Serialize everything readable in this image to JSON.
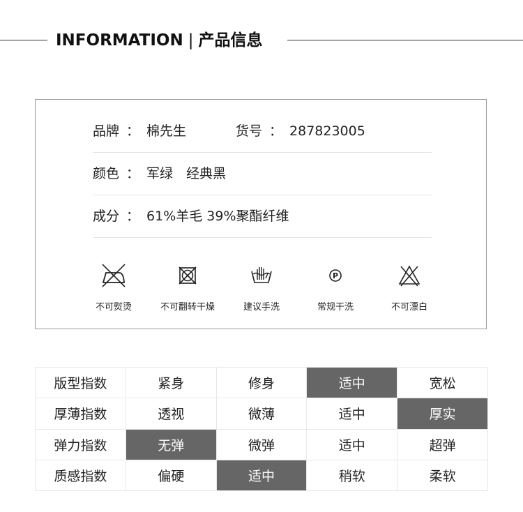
{
  "header": {
    "title_en": "INFORMATION",
    "separator": "|",
    "title_cn": "产品信息"
  },
  "info": {
    "brand_label": "品牌",
    "brand_value": "棉先生",
    "sku_label": "货号",
    "sku_value": "287823005",
    "color_label": "颜色",
    "color_value": "军绿　经典黑",
    "composition_label": "成分",
    "composition_value": "61%羊毛 39%聚酯纤维",
    "colon": "："
  },
  "care": [
    {
      "icon": "no-iron-icon",
      "label": "不可熨烫"
    },
    {
      "icon": "no-tumble-dry-icon",
      "label": "不可翻转干燥"
    },
    {
      "icon": "hand-wash-icon",
      "label": "建议手洗"
    },
    {
      "icon": "dry-clean-icon",
      "label": "常规干洗",
      "glyph": "P"
    },
    {
      "icon": "no-bleach-icon",
      "label": "不可漂白"
    }
  ],
  "index_table": {
    "highlight_color": "#666666",
    "rows": [
      {
        "name": "版型指数",
        "options": [
          "紧身",
          "修身",
          "适中",
          "宽松"
        ],
        "selected": 2
      },
      {
        "name": "厚薄指数",
        "options": [
          "透视",
          "微薄",
          "适中",
          "厚实"
        ],
        "selected": 3
      },
      {
        "name": "弹力指数",
        "options": [
          "无弹",
          "微弹",
          "适中",
          "超弹"
        ],
        "selected": 0
      },
      {
        "name": "质感指数",
        "options": [
          "偏硬",
          "适中",
          "稍软",
          "柔软"
        ],
        "selected": 1
      }
    ]
  }
}
